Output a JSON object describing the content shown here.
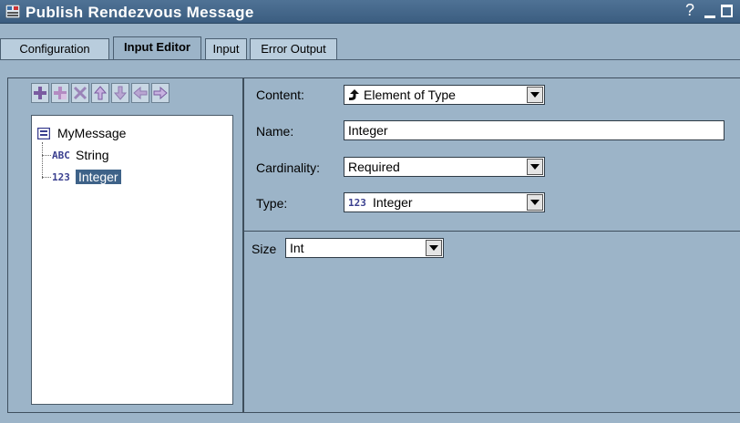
{
  "window": {
    "title": "Publish Rendezvous Message",
    "help_glyph": "?"
  },
  "tabs": [
    {
      "label": "Configuration",
      "active": false
    },
    {
      "label": "Input Editor",
      "active": true
    },
    {
      "label": "Input",
      "active": false
    },
    {
      "label": "Error Output",
      "active": false
    }
  ],
  "toolbar": {
    "buttons": [
      "add-icon",
      "add-child-icon",
      "delete-icon",
      "move-up-icon",
      "move-down-icon",
      "move-left-icon",
      "move-right-icon"
    ]
  },
  "tree": {
    "root": {
      "label": "MyMessage",
      "icon": "message-icon"
    },
    "children": [
      {
        "label": "String",
        "icon": "string-type-icon",
        "selected": false
      },
      {
        "label": "Integer",
        "icon": "integer-type-icon",
        "selected": true
      }
    ]
  },
  "form": {
    "content_label": "Content:",
    "content_value": "Element of Type",
    "name_label": "Name:",
    "name_value": "Integer",
    "cardinality_label": "Cardinality:",
    "cardinality_value": "Required",
    "type_label": "Type:",
    "type_value": "Integer"
  },
  "size": {
    "label": "Size",
    "value": "Int"
  },
  "colors": {
    "titlebar": "#3b5d80",
    "panel": "#9cb4c8",
    "selection": "#3e6288",
    "icon_glyph": "#3a3f8f"
  }
}
